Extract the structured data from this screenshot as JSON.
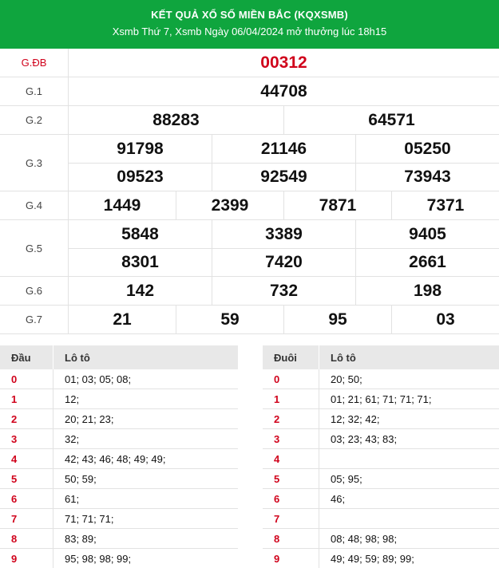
{
  "header": {
    "title": "KẾT QUẢ XỔ SỐ MIỀN BẮC (KQXSMB)",
    "subtitle": "Xsmb Thứ 7, Xsmb Ngày 06/04/2024 mở thưởng lúc 18h15"
  },
  "prizes": [
    {
      "label": "G.ĐB",
      "lines": [
        [
          "00312"
        ]
      ]
    },
    {
      "label": "G.1",
      "lines": [
        [
          "44708"
        ]
      ]
    },
    {
      "label": "G.2",
      "lines": [
        [
          "88283",
          "64571"
        ]
      ]
    },
    {
      "label": "G.3",
      "lines": [
        [
          "91798",
          "21146",
          "05250"
        ],
        [
          "09523",
          "92549",
          "73943"
        ]
      ]
    },
    {
      "label": "G.4",
      "lines": [
        [
          "1449",
          "2399",
          "7871",
          "7371"
        ]
      ]
    },
    {
      "label": "G.5",
      "lines": [
        [
          "5848",
          "3389",
          "9405"
        ],
        [
          "8301",
          "7420",
          "2661"
        ]
      ]
    },
    {
      "label": "G.6",
      "lines": [
        [
          "142",
          "732",
          "198"
        ]
      ]
    },
    {
      "label": "G.7",
      "lines": [
        [
          "21",
          "59",
          "95",
          "03"
        ]
      ]
    }
  ],
  "loto_head": {
    "col1": "Đầu",
    "col2": "Lô tô",
    "rows": [
      {
        "k": "0",
        "v": "01; 03; 05; 08;"
      },
      {
        "k": "1",
        "v": "12;"
      },
      {
        "k": "2",
        "v": "20; 21; 23;"
      },
      {
        "k": "3",
        "v": "32;"
      },
      {
        "k": "4",
        "v": "42; 43; 46; 48; 49; 49;"
      },
      {
        "k": "5",
        "v": "50; 59;"
      },
      {
        "k": "6",
        "v": "61;"
      },
      {
        "k": "7",
        "v": "71; 71; 71;"
      },
      {
        "k": "8",
        "v": "83; 89;"
      },
      {
        "k": "9",
        "v": "95; 98; 98; 99;"
      }
    ]
  },
  "loto_tail": {
    "col1": "Đuôi",
    "col2": "Lô tô",
    "rows": [
      {
        "k": "0",
        "v": "20; 50;"
      },
      {
        "k": "1",
        "v": "01; 21; 61; 71; 71; 71;"
      },
      {
        "k": "2",
        "v": "12; 32; 42;"
      },
      {
        "k": "3",
        "v": "03; 23; 43; 83;"
      },
      {
        "k": "4",
        "v": ""
      },
      {
        "k": "5",
        "v": "05; 95;"
      },
      {
        "k": "6",
        "v": "46;"
      },
      {
        "k": "7",
        "v": ""
      },
      {
        "k": "8",
        "v": "08; 48; 98; 98;"
      },
      {
        "k": "9",
        "v": "49; 49; 59; 89; 99;"
      }
    ]
  },
  "colors": {
    "header_bg": "#0fa53e",
    "special_prize": "#d0021b",
    "digit_key": "#d0021b"
  }
}
